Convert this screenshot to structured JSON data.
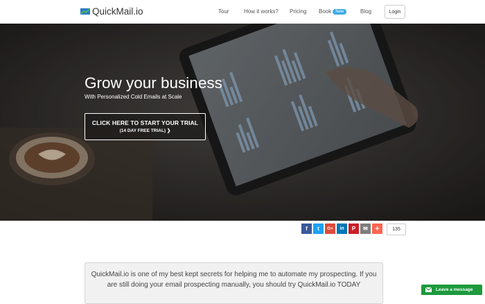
{
  "nav": {
    "brand": "QuickMail.io",
    "items": [
      {
        "label": "Tour"
      },
      {
        "label": "How it works?"
      },
      {
        "label": "Pricing"
      },
      {
        "label": "Book",
        "badge": "New"
      },
      {
        "label": "Blog"
      }
    ],
    "login": "Login",
    "accent": "#3aaae0"
  },
  "hero": {
    "title": "Grow your business",
    "subtitle": "With Personalized Cold Emails at Scale",
    "cta_line1": "CLICK HERE TO START YOUR TRIAL",
    "cta_line2": "(14 DAY FREE TRIAL)",
    "cta_arrow": "❯"
  },
  "share": {
    "buttons": [
      {
        "name": "facebook",
        "glyph": "f",
        "color": "#3b5998"
      },
      {
        "name": "twitter",
        "glyph": "t",
        "color": "#1da1f2"
      },
      {
        "name": "google-plus",
        "glyph": "G+",
        "color": "#dd4b39"
      },
      {
        "name": "linkedin",
        "glyph": "in",
        "color": "#0077b5"
      },
      {
        "name": "pinterest",
        "glyph": "P",
        "color": "#cb2027"
      },
      {
        "name": "email",
        "glyph": "✉",
        "color": "#7d7d7d"
      },
      {
        "name": "more",
        "glyph": "+",
        "color": "#ff6550"
      }
    ],
    "count": "135"
  },
  "testimonial": {
    "text": "QuickMail.io is one of my best kept secrets for helping me to automate my prospecting. If you are still doing your email prospecting manually, you should try QuickMail.io TODAY"
  },
  "chat": {
    "label": "Leave a message",
    "color": "#1c9a3c"
  }
}
